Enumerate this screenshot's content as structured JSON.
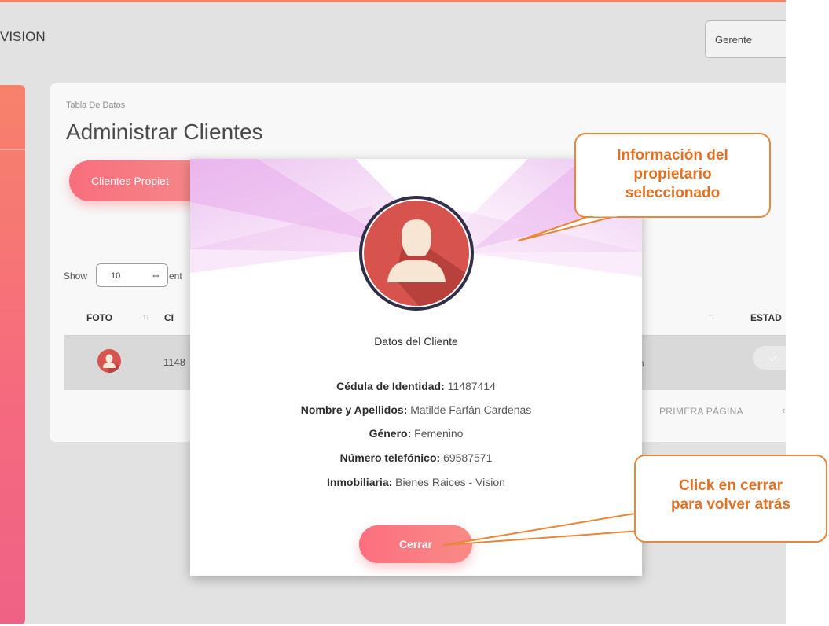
{
  "header": {
    "brand": "VISION",
    "role": "Gerente"
  },
  "main": {
    "breadcrumb": "Tabla De Datos",
    "title": "Administrar Clientes",
    "tab_button": "Clientes Propiet",
    "show_label": "Show",
    "show_value": "10",
    "entries_label": "ent",
    "columns": [
      "FOTO",
      "CI",
      "ESTAD"
    ],
    "row": {
      "ci": "1148",
      "tail": "n"
    },
    "pager_first": "PRIMERA PÁGINA",
    "pager_prev": "‹"
  },
  "modal": {
    "heading": "Datos del Cliente",
    "fields": [
      {
        "label": "Cédula de Identidad:",
        "value": "11487414"
      },
      {
        "label": "Nombre y Apellidos:",
        "value": "Matilde Farfán Cardenas"
      },
      {
        "label": "Género:",
        "value": "Femenino"
      },
      {
        "label": "Número telefónico:",
        "value": "69587571"
      },
      {
        "label": "Inmobiliaria:",
        "value": "Bienes Raices - Vision"
      }
    ],
    "close_button": "Cerrar"
  },
  "callouts": {
    "info_line1": "Información del",
    "info_line2": "propietario",
    "info_line3": "seleccionado",
    "close_line1": "Click en cerrar",
    "close_line2": "para volver atrás"
  },
  "colors": {
    "accent": "#f86e7d",
    "callout": "#e37124",
    "avatar": "#d6544d"
  },
  "icons": [
    "user-avatar-icon",
    "sort-icon",
    "select-arrows-icon",
    "toggle-check-icon"
  ]
}
